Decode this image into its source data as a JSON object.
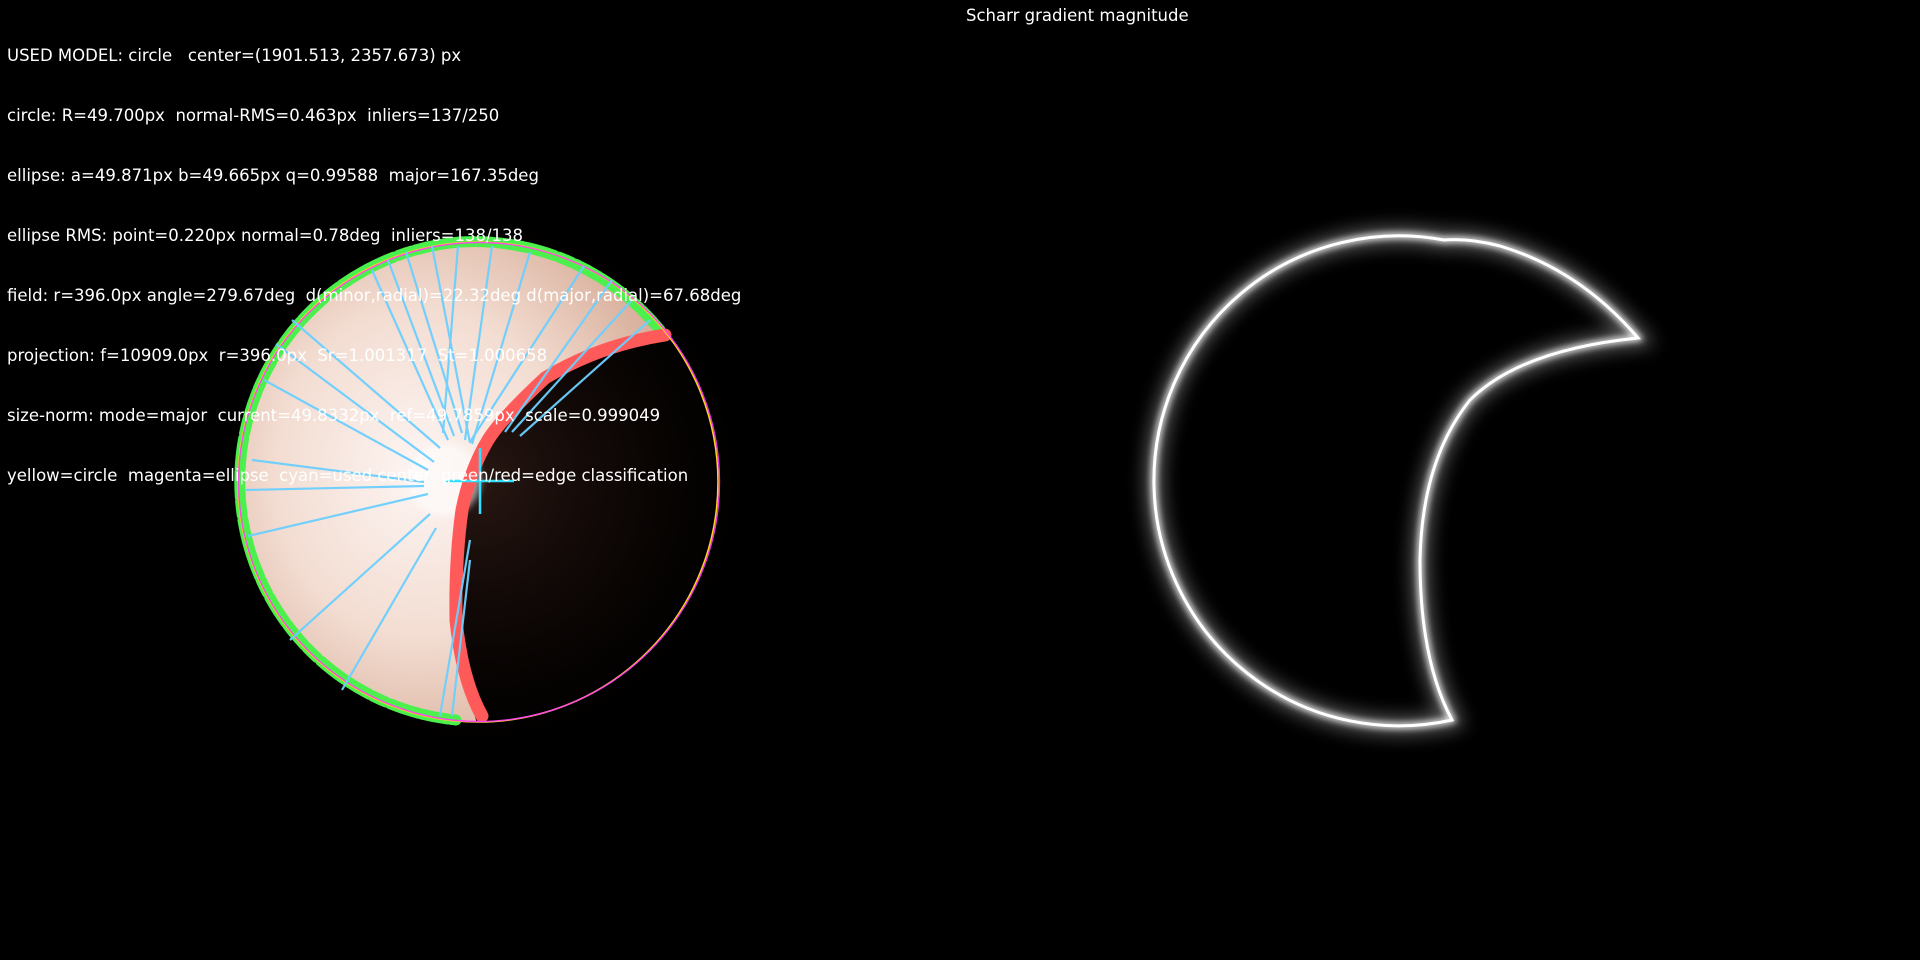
{
  "left_panel": {
    "info_lines": [
      "USED MODEL: circle   center=(1901.513, 2357.673) px",
      "circle: R=49.700px  normal-RMS=0.463px  inliers=137/250",
      "ellipse: a=49.871px b=49.665px q=0.99588  major=167.35deg",
      "ellipse RMS: point=0.220px normal=0.78deg  inliers=138/138",
      "field: r=396.0px angle=279.67deg  d(minor,radial)=22.32deg d(major,radial)=67.68deg",
      "projection: f=10909.0px  r=396.0px  Sr=1.001317  St=1.000658",
      "size-norm: mode=major  current=49.8332px  ref=49.7859px  scale=0.999049",
      "yellow=circle  magenta=ellipse  cyan=used center  green/red=edge classification"
    ]
  },
  "right_panel": {
    "title": "Scharr gradient magnitude"
  },
  "colors": {
    "background": "#000000",
    "circle_fit": "#ffd21e",
    "ellipse_fit": "#ff3cff",
    "used_center": "#31e0ff",
    "edge_inlier": "#4cf04c",
    "edge_outlier": "#ff5a5a",
    "ray": "#6ccfff",
    "disk_fill": "#f3ded6"
  }
}
